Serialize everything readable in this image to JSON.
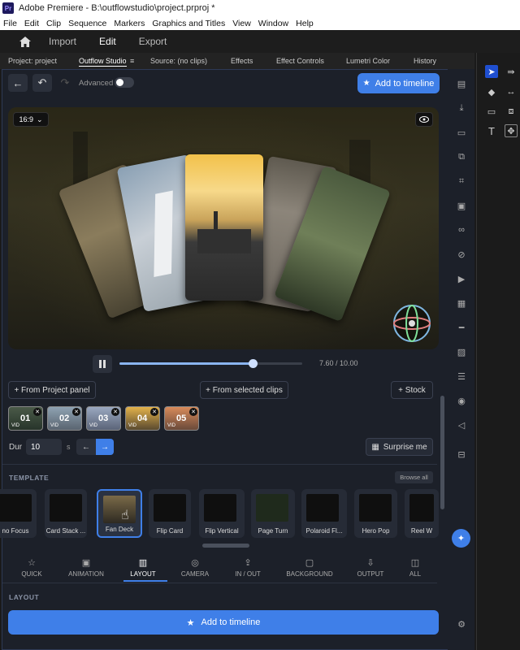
{
  "titlebar": {
    "app_icon": "Pr",
    "title": "Adobe Premiere - B:\\outflowstudio\\project.prproj *"
  },
  "menu": [
    "File",
    "Edit",
    "Clip",
    "Sequence",
    "Markers",
    "Graphics and Titles",
    "View",
    "Window",
    "Help"
  ],
  "workspace": {
    "home_icon": "home-icon",
    "tabs": [
      "Import",
      "Edit",
      "Export"
    ],
    "active": "Edit"
  },
  "panel_tabs": [
    "Project: project",
    "Outflow Studio",
    "Source: (no clips)",
    "Effects",
    "Effect Controls",
    "Lumetri Color",
    "History"
  ],
  "panel_menu_icon": "≡",
  "toolbar": {
    "advanced_label": "Advanced",
    "add_to_timeline": "Add to timeline"
  },
  "preview": {
    "aspect": "16:9",
    "aspect_chevron": "⌄",
    "time_display": "7.60 / 10.00",
    "scrub_fraction": 0.73
  },
  "sources": {
    "from_project": "+ From Project panel",
    "from_selected": "+ From selected clips",
    "stock": "+ Stock"
  },
  "clips": [
    {
      "num": "01",
      "badge": "VID"
    },
    {
      "num": "02",
      "badge": "VID"
    },
    {
      "num": "03",
      "badge": "VID"
    },
    {
      "num": "04",
      "badge": "VID"
    },
    {
      "num": "05",
      "badge": "VID"
    }
  ],
  "duration": {
    "label": "Dur",
    "value": "10",
    "unit": "s",
    "surprise": "Surprise me"
  },
  "template": {
    "heading": "TEMPLATE",
    "browse_all": "Browse all",
    "items": [
      "no Focus",
      "Card Stack ...",
      "Fan Deck",
      "Flip Card",
      "Flip Vertical",
      "Page Turn",
      "Polaroid Fl...",
      "Hero Pop",
      "Reel W"
    ],
    "selected": "Fan Deck"
  },
  "categories": [
    {
      "label": "QUICK",
      "icon": "☆"
    },
    {
      "label": "ANIMATION",
      "icon": "▣"
    },
    {
      "label": "LAYOUT",
      "icon": "▥"
    },
    {
      "label": "CAMERA",
      "icon": "◎"
    },
    {
      "label": "IN / OUT",
      "icon": "⇪"
    },
    {
      "label": "BACKGROUND",
      "icon": "▢"
    },
    {
      "label": "OUTPUT",
      "icon": "⇩"
    },
    {
      "label": "ALL",
      "icon": "◫"
    }
  ],
  "active_category": "LAYOUT",
  "layout_heading": "LAYOUT",
  "bottom_add": "Add to timeline",
  "colors": {
    "accent": "#3f7fe8",
    "panel_bg": "#1c2029",
    "selected_border": "#3f7fe8"
  }
}
